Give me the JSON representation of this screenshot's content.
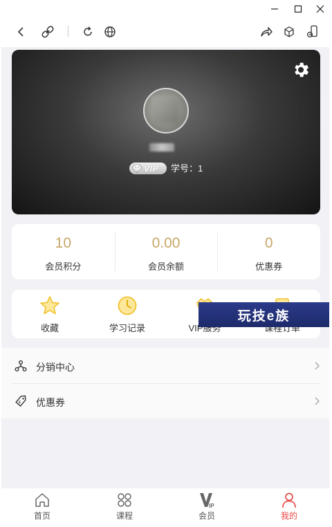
{
  "window": {
    "controls": [
      {
        "name": "minimize-icon"
      },
      {
        "name": "maximize-icon"
      },
      {
        "name": "close-icon"
      }
    ]
  },
  "toolbar": {
    "icons": [
      "back-icon",
      "link-icon",
      "refresh-icon",
      "globe-icon",
      "share-icon",
      "cube-icon",
      "phone-rotate-icon"
    ]
  },
  "profile": {
    "vip_text": "VIP",
    "student_no": "学号：1"
  },
  "stats": [
    {
      "value": "10",
      "label": "会员积分"
    },
    {
      "value": "0.00",
      "label": "会员余额"
    },
    {
      "value": "0",
      "label": "优惠券"
    }
  ],
  "actions": [
    {
      "label": "收藏",
      "icon": "star-icon"
    },
    {
      "label": "学习记录",
      "icon": "clock-icon"
    },
    {
      "label": "VIP服务",
      "icon": "vip-crown-icon"
    },
    {
      "label": "课程订单",
      "icon": "order-icon"
    }
  ],
  "watermark": "玩技e族",
  "menu": [
    {
      "label": "分销中心",
      "icon": "distribution-icon"
    },
    {
      "label": "优惠券",
      "icon": "coupon-tag-icon"
    }
  ],
  "nav": [
    {
      "label": "首页",
      "icon": "home-icon",
      "active": false
    },
    {
      "label": "课程",
      "icon": "course-icon",
      "active": false
    },
    {
      "label": "会员",
      "icon": "vip-icon",
      "active": false
    },
    {
      "label": "我的",
      "icon": "user-icon",
      "active": true
    }
  ],
  "colors": {
    "accent_gold": "#c8a766",
    "active_red": "#e84a4a",
    "page_bg": "#f2f2f6"
  }
}
